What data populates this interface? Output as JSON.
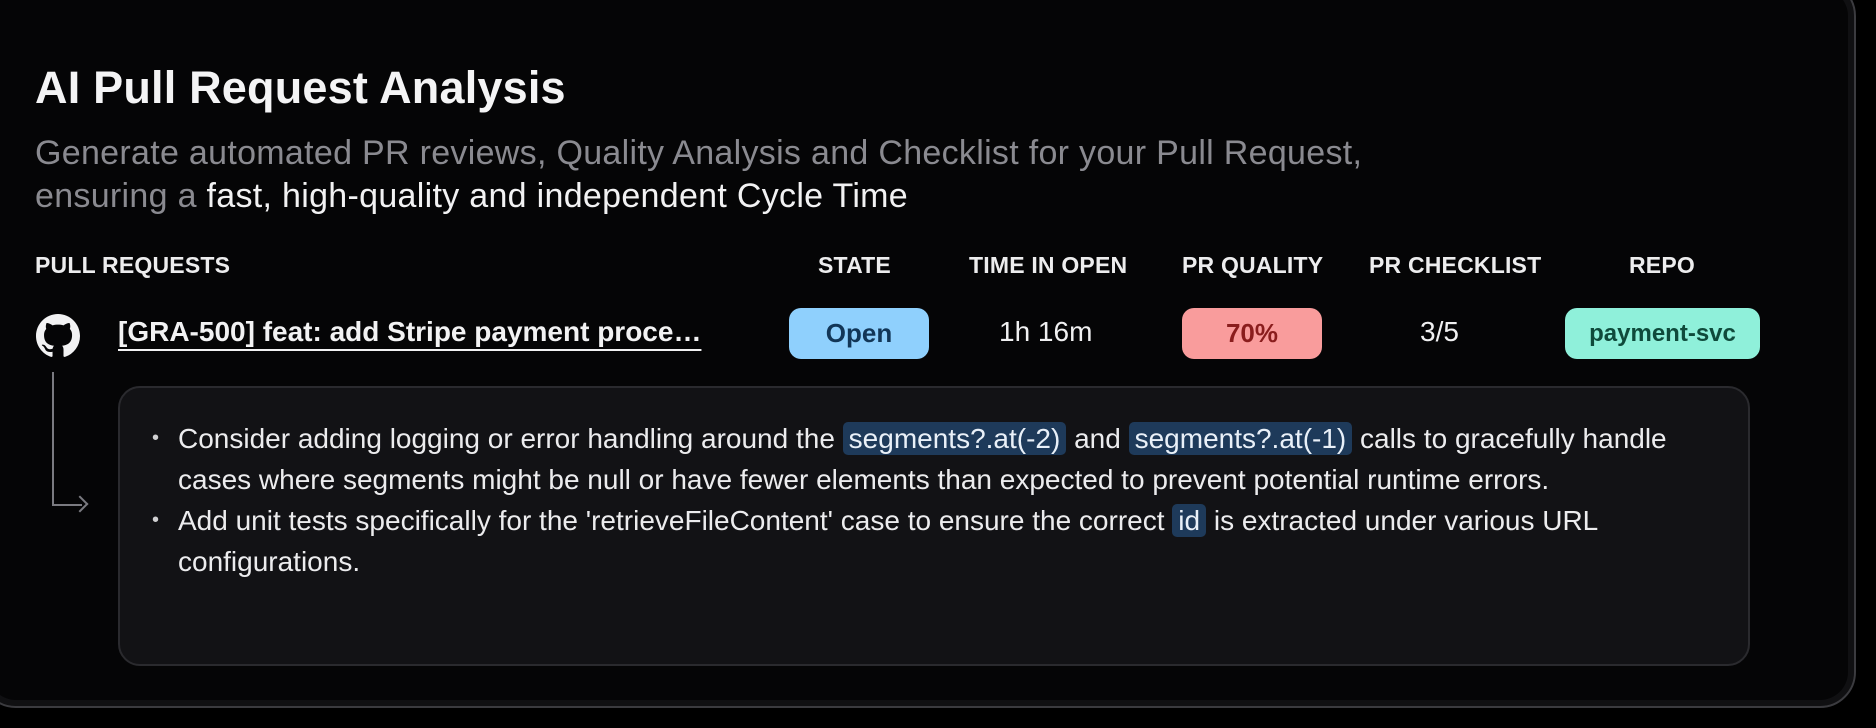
{
  "title": "AI Pull Request Analysis",
  "subtitle": {
    "line1": "Generate automated PR reviews, Quality Analysis and Checklist for your Pull Request,",
    "line2_prefix": "ensuring a ",
    "line2_emphasis": "fast, high-quality and independent Cycle Time"
  },
  "table": {
    "headers": {
      "pull_requests": "PULL REQUESTS",
      "state": "STATE",
      "time_in_open": "TIME IN OPEN",
      "pr_quality": "PR QUALITY",
      "pr_checklist": "PR CHECKLIST",
      "repo": "REPO"
    },
    "row": {
      "pr_title": "[GRA-500] feat: add Stripe payment proce…",
      "state": "Open",
      "time_in_open": "1h 16m",
      "pr_quality": "70%",
      "pr_checklist": "3/5",
      "repo": "payment-svc"
    }
  },
  "suggestions": [
    {
      "p1": "Consider adding logging or error handling around the ",
      "code1": "segments?.at(-2)",
      "p2": " and ",
      "code2": "segments?.at(-1)",
      "p3": " calls to gracefully handle cases where segments might be null or have fewer elements than expected to prevent potential runtime errors."
    },
    {
      "p1": "Add unit tests specifically for the 'retrieveFileContent' case to ensure the correct ",
      "code1": "id",
      "p2": " is extracted under various URL configurations."
    }
  ],
  "colors": {
    "state_pill": "#8fd0fd",
    "quality_pill": "#f99c9c",
    "repo_pill": "#8ff0da",
    "code_highlight": "#1e3a5a"
  },
  "icons": {
    "pr_source": "github-icon"
  }
}
